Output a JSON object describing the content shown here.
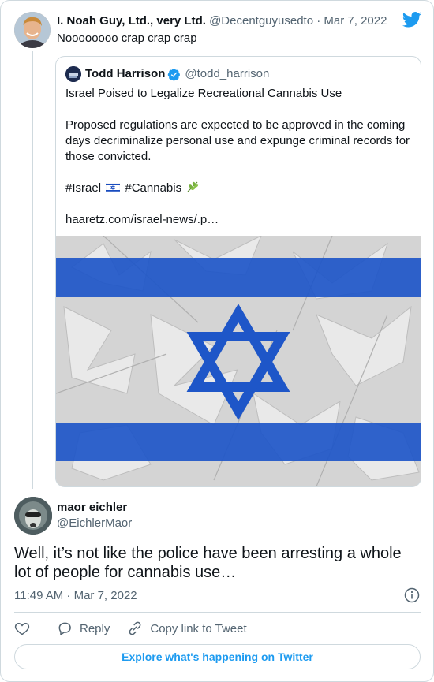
{
  "parent_tweet": {
    "display_name": "I. Noah Guy, Ltd., very Ltd.",
    "handle": "@Decentguyusedto",
    "separator": "·",
    "date": "Mar 7, 2022",
    "text": "Noooooooo crap crap crap"
  },
  "quoted_tweet": {
    "display_name": "Todd Harrison",
    "handle": "@todd_harrison",
    "verified": true,
    "title_line": "Israel Poised to Legalize Recreational Cannabis Use",
    "paragraph": "Proposed regulations are expected to be approved in the coming days decriminalize personal use and expunge criminal records for those convicted.",
    "hashtag_1": "#Israel",
    "hashtag_2": "#Cannabis",
    "link": "haaretz.com/israel-news/.p…",
    "image_icon": "israel-flag-over-cannabis-leaves"
  },
  "reply_tweet": {
    "display_name": "maor eichler",
    "handle": "@EichlerMaor",
    "text": "Well, it’s not like the police have been arresting a whole lot of people for cannabis use…",
    "timestamp": "11:49 AM · Mar 7, 2022"
  },
  "actions": {
    "like_icon": "heart-icon",
    "reply_label": "Reply",
    "copy_link_label": "Copy link to Tweet"
  },
  "footer": {
    "explore_label": "Explore what's happening on Twitter"
  },
  "colors": {
    "accent": "#1d9bf0",
    "secondary_text": "#536471",
    "border": "#cfd9de",
    "verified_badge": "#1d9bf0",
    "flag_blue": "#0038b8"
  }
}
